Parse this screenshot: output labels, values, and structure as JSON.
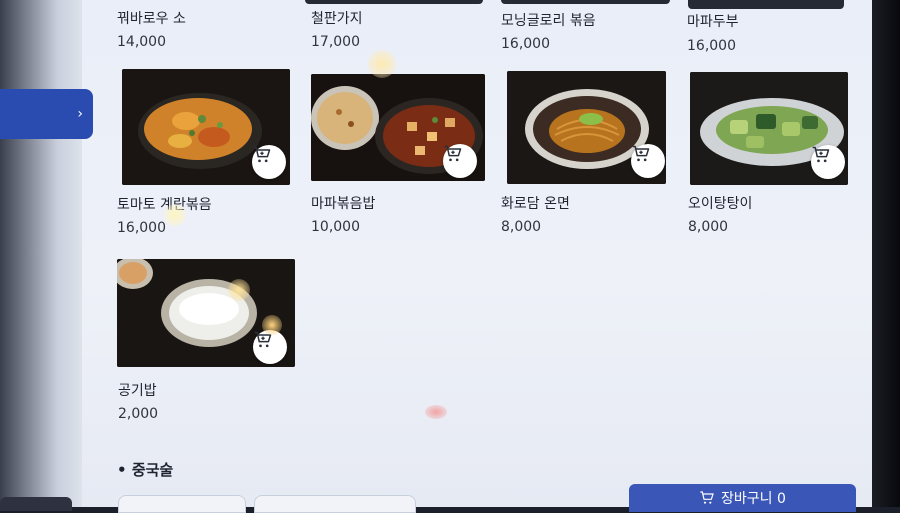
{
  "menu": {
    "top_row": [
      {
        "name": "꿔바로우 소",
        "price": "14,000"
      },
      {
        "name": "철판가지",
        "price": "17,000"
      },
      {
        "name": "모닝글로리 볶음",
        "price": "16,000"
      },
      {
        "name": "마파두부",
        "price": "16,000"
      }
    ],
    "middle_row": [
      {
        "name": "토마토 계란볶음",
        "price": "16,000"
      },
      {
        "name": "마파볶음밥",
        "price": "10,000"
      },
      {
        "name": "화로담 온면",
        "price": "8,000"
      },
      {
        "name": "오이탕탕이",
        "price": "8,000"
      }
    ],
    "bottom_row": [
      {
        "name": "공기밥",
        "price": "2,000"
      }
    ]
  },
  "section": {
    "bullet": "•",
    "title": "중국술"
  },
  "side_tab": {
    "arrow": "›"
  },
  "cart_bar": {
    "label": "장바구니 0"
  },
  "icons": {
    "cart": "shopping-cart-icon",
    "chevron": "chevron-right-icon"
  },
  "colors": {
    "accent": "#2a4bb0",
    "cart_bar": "#3a56b6",
    "screen_bg": "#e9eef8"
  }
}
